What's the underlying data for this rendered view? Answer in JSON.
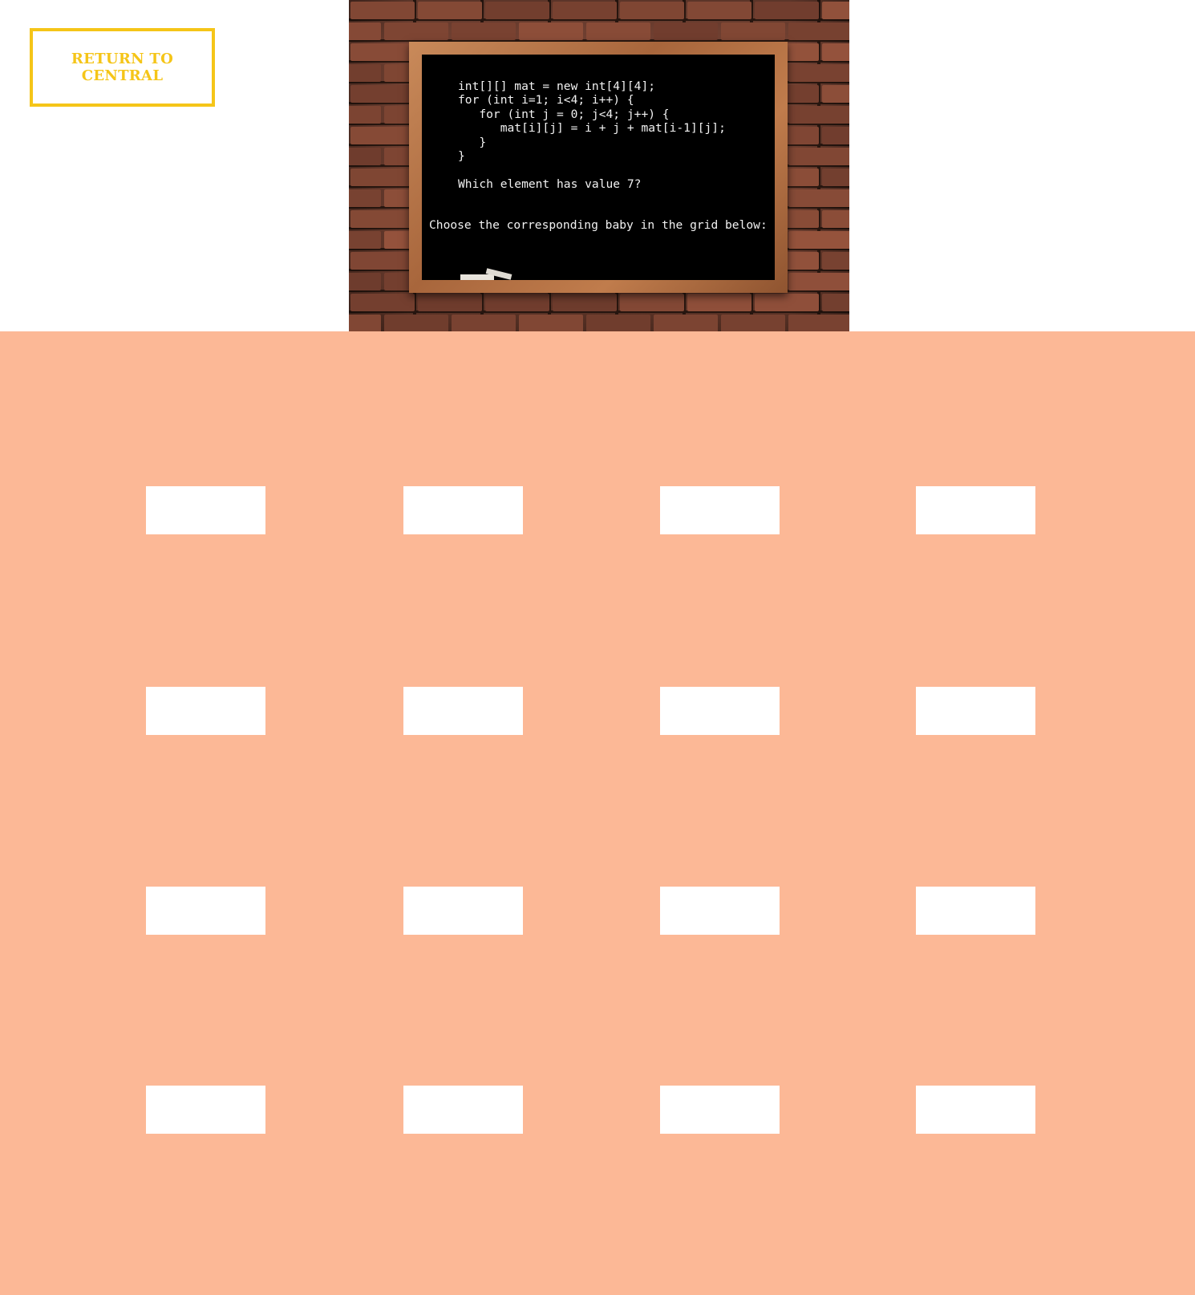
{
  "nav": {
    "return_label": "RETURN TO CENTRAL"
  },
  "chalkboard": {
    "code": "int[][] mat = new int[4][4];\nfor (int i=1; i<4; i++) {\n   for (int j = 0; j<4; j++) {\n      mat[i][j] = i + j + mat[i-1][j];\n   }\n}",
    "question": "Which element has value 7?",
    "instruction": "Choose the corresponding baby in the grid below:"
  },
  "grid": {
    "rows": 4,
    "columns": 4,
    "cells": [
      "",
      "",
      "",
      "",
      "",
      "",
      "",
      "",
      "",
      "",
      "",
      "",
      "",
      "",
      "",
      ""
    ]
  },
  "colors": {
    "accent": "#f5c518",
    "grid_background": "#fcb896",
    "cell_background": "#ffffff",
    "board_background": "#000000",
    "chalk_text": "#f2f2f2"
  }
}
